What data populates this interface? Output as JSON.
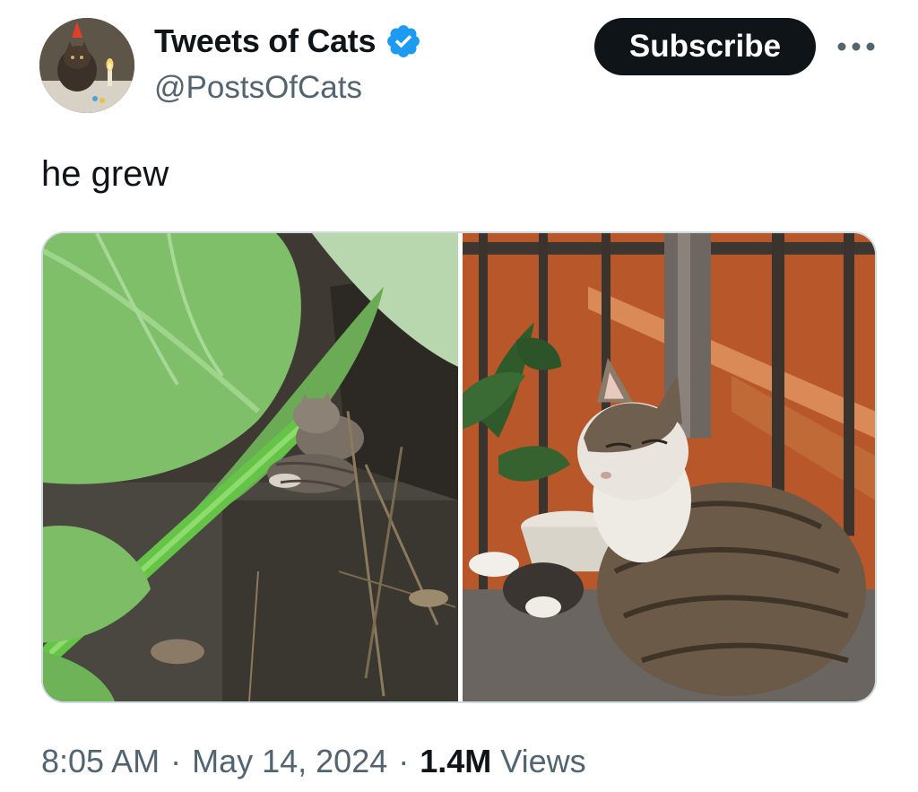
{
  "tweet": {
    "author": {
      "display_name": "Tweets of Cats",
      "handle": "@PostsOfCats",
      "verified": true,
      "verified_color": "#1d9bf0",
      "avatar_icon": "cat-with-party-hat-avatar"
    },
    "subscribe_label": "Subscribe",
    "more_icon": "more-horizontal-icon",
    "text": "he grew",
    "media": [
      {
        "description_icon": "kitten-under-leaves-photo"
      },
      {
        "description_icon": "grown-cat-curled-by-railing-photo"
      }
    ],
    "time": "8:05 AM",
    "date": "May 14, 2024",
    "separator": "·",
    "views_count": "1.4M",
    "views_label": "Views"
  },
  "colors": {
    "text_primary": "#0f1419",
    "text_secondary": "#536471",
    "subscribe_bg": "#0f1419",
    "border": "#cfd9de"
  }
}
